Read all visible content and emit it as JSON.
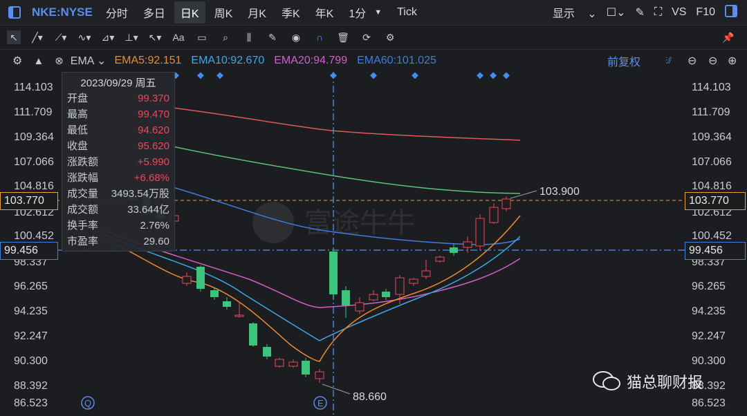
{
  "header": {
    "symbol": "NKE:NYSE",
    "periods": [
      "分时",
      "多日",
      "日K",
      "周K",
      "月K",
      "季K",
      "年K",
      "1分",
      "Tick"
    ],
    "active_period": "日K",
    "display_label": "显示",
    "vs_label": "VS",
    "f10_label": "F10"
  },
  "indicator_bar": {
    "indicator": "EMA",
    "ema5": "EMA5:92.151",
    "ema10": "EMA10:92.670",
    "ema20": "EMA20:94.799",
    "ema60": "EMA60:101.025",
    "adjust": "前复权",
    "colors": {
      "ema5": "#f08a2c",
      "ema10": "#3fa8e8",
      "ema20": "#d45fc7",
      "ema60": "#3f7de0"
    }
  },
  "tooltip": {
    "date": "2023/09/29 周五",
    "rows": [
      {
        "k": "开盘",
        "v": "99.370"
      },
      {
        "k": "最高",
        "v": "99.470"
      },
      {
        "k": "最低",
        "v": "94.620"
      },
      {
        "k": "收盘",
        "v": "95.620"
      },
      {
        "k": "涨跌额",
        "v": "+5.990"
      },
      {
        "k": "涨跌幅",
        "v": "+6.68%"
      },
      {
        "k": "成交量",
        "v": "3493.54万股"
      },
      {
        "k": "成交额",
        "v": "33.644亿"
      },
      {
        "k": "换手率",
        "v": "2.76%"
      },
      {
        "k": "市盈率",
        "v": "29.60"
      }
    ]
  },
  "price_axis": {
    "left": [
      "114.103",
      "111.709",
      "109.364",
      "107.066",
      "104.816",
      "102.612",
      "100.452",
      "98.337",
      "96.265",
      "94.235",
      "92.247",
      "90.300",
      "88.392",
      "86.523"
    ],
    "right": [
      "114.103",
      "111.709",
      "109.364",
      "107.066",
      "104.816",
      "102.612",
      "100.452",
      "98.337",
      "96.265",
      "94.235",
      "92.247",
      "90.300",
      "88.392",
      "86.523"
    ]
  },
  "markers": {
    "high_label": "103.900",
    "low_label": "88.660",
    "current_price": "103.770",
    "crosshair_price": "99.456",
    "q_marker": "Q",
    "e_marker": "E"
  },
  "watermark": {
    "brand": "富途牛牛",
    "source": "猫总聊财报"
  },
  "colors": {
    "up": "#f0475a",
    "down": "#3cc47c",
    "current_line": "#e8a23a",
    "crosshair": "#4a7ed8",
    "accent": "#5a8ef0"
  }
}
